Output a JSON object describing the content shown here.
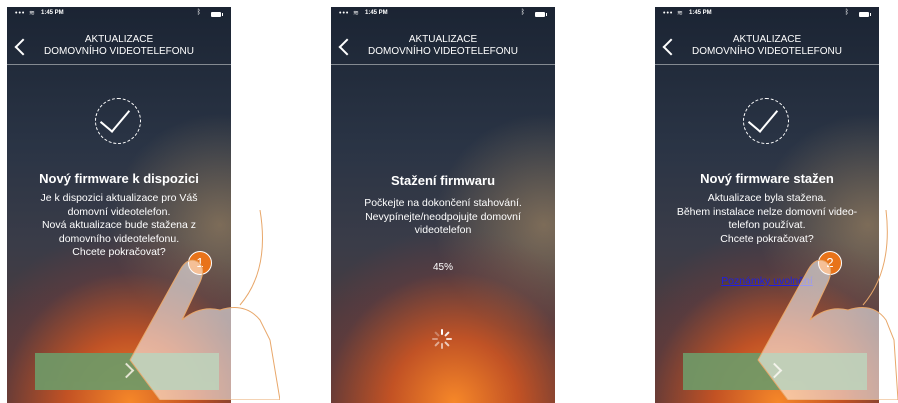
{
  "status_bar": {
    "time": "1:45 PM"
  },
  "header": {
    "line1": "AKTUALIZACE",
    "line2": "DOMOVNÍHO VIDEOTELEFONU"
  },
  "screens": [
    {
      "title": "Nový firmware k dispozici",
      "body": [
        "Je k dispozici aktualizace pro Váš",
        "domovní videotelefon.",
        "Nová aktualizace bude stažena z",
        "domovního videotelefonu.",
        "Chcete pokračovat?"
      ],
      "badge": "1",
      "next_icon": "chevron-right-icon"
    },
    {
      "title": "Stažení firmwaru",
      "body": [
        "Počkejte na dokončení stahování.",
        "Nevypínejte/neodpojujte domovní",
        "videotelefon"
      ],
      "progress": "45%",
      "spinner_icon": "loading-spinner-icon"
    },
    {
      "title": "Nový firmware stažen",
      "body": [
        "Aktualizace byla stažena.",
        "Během instalace nelze domovní video-",
        "telefon používat.",
        "Chcete pokračovat?"
      ],
      "link": "Poznámky uvolnění",
      "badge": "2",
      "next_icon": "chevron-right-icon"
    }
  ],
  "colors": {
    "accent_button": "#6f9a68",
    "badge": "#e8731a",
    "link": "#2020e0"
  }
}
